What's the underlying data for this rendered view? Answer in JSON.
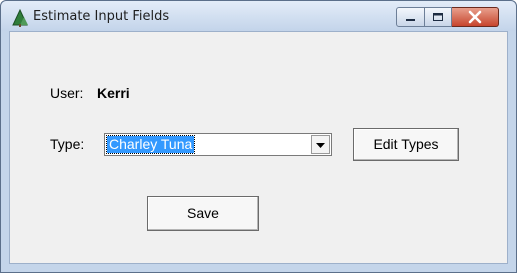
{
  "window": {
    "title": "Estimate Input Fields",
    "controls": {
      "minimize": "minimize",
      "maximize": "maximize",
      "close": "close"
    }
  },
  "form": {
    "user_label": "User:",
    "user_value": "Kerri",
    "type_label": "Type:",
    "type_selected": "Charley Tuna",
    "edit_types_label": "Edit Types",
    "save_label": "Save"
  },
  "colors": {
    "selection": "#3399ff",
    "close_button": "#c7452d",
    "client_background": "#f0f0f0"
  }
}
